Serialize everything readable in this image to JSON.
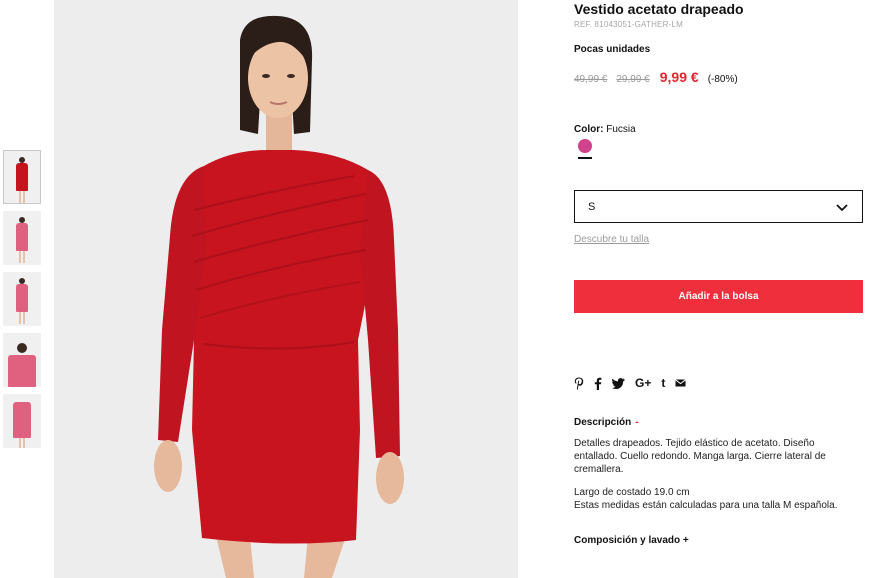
{
  "product": {
    "title": "Vestido acetato drapeado",
    "ref": "REF. 81043051-GATHER-LM",
    "stock": "Pocas unidades",
    "price_original": "49,99 €",
    "price_previous": "29,99 €",
    "price_current": "9,99 €",
    "discount": "(-80%)",
    "price_colors": {
      "current": "#e2262e",
      "crossed": "#9a9a9a"
    }
  },
  "color": {
    "label": "Color:",
    "value": "Fucsia",
    "swatch": "#d0428c"
  },
  "size": {
    "selected": "S",
    "guide_link": "Descubre tu talla"
  },
  "cart": {
    "button_label": "Añadir a la bolsa",
    "button_color": "#ef2f3b"
  },
  "share": {
    "icons": [
      "pinterest-icon",
      "facebook-icon",
      "twitter-icon",
      "google-plus-icon",
      "tumblr-icon",
      "email-icon"
    ]
  },
  "description": {
    "title": "Descripción",
    "toggle": "-",
    "text": "Detalles drapeados. Tejido elástico de acetato. Diseño entallado. Cuello redondo. Manga larga. Cierre lateral de cremallera.",
    "measure_line": "Largo de costado 19.0 cm",
    "measure_note": "Estas medidas están calculadas para una talla M española."
  },
  "composition": {
    "title": "Composición y lavado",
    "toggle": "+"
  },
  "gallery": {
    "thumbnails": [
      {
        "name": "front-red"
      },
      {
        "name": "full-pink"
      },
      {
        "name": "full-pink-2"
      },
      {
        "name": "detail-pink"
      },
      {
        "name": "back-pink"
      }
    ],
    "dress_color": "#c8141f"
  }
}
